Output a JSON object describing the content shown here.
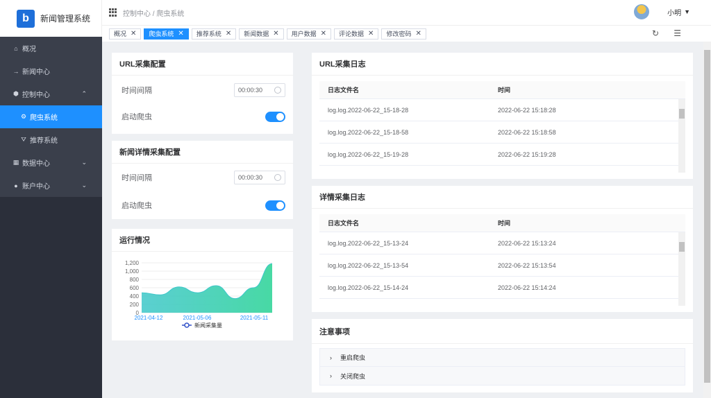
{
  "app": {
    "title": "新闻管理系统",
    "logo_letter": "b"
  },
  "menu": {
    "items": [
      {
        "label": "概况",
        "icon": "home-icon"
      },
      {
        "label": "新闻中心",
        "icon": "arrow-right-icon"
      },
      {
        "label": "控制中心",
        "icon": "cube-icon",
        "expanded": true
      },
      {
        "label": "爬虫系统",
        "icon": "gear-icon",
        "active": true
      },
      {
        "label": "推荐系统",
        "icon": "filter-icon"
      },
      {
        "label": "数据中心",
        "icon": "data-icon"
      },
      {
        "label": "账户中心",
        "icon": "user-icon"
      }
    ]
  },
  "header": {
    "breadcrumb": "控制中心 / 爬虫系统",
    "username": "小明"
  },
  "tags": [
    "概况",
    "爬虫系统",
    "推荐系统",
    "新闻数据",
    "用户数据",
    "评论数据",
    "修改密码"
  ],
  "active_tag": "爬虫系统",
  "url_config": {
    "title": "URL采集配置",
    "interval_label": "时间间隔",
    "interval_value": "00:00:30",
    "start_label": "启动爬虫",
    "start_on": true
  },
  "detail_config": {
    "title": "新闻详情采集配置",
    "interval_label": "时间间隔",
    "interval_value": "00:00:30",
    "start_label": "启动爬虫",
    "start_on": true
  },
  "status": {
    "title": "运行情况"
  },
  "chart_data": {
    "type": "area",
    "x": [
      "2021-04-12",
      "2021-05-06",
      "2021-05-11"
    ],
    "yticks": [
      "1,200",
      "1,000",
      "800",
      "600",
      "400",
      "200",
      "0"
    ],
    "ylim": [
      0,
      1200
    ],
    "series": [
      {
        "name": "新闻采集量",
        "values": [
          480,
          430,
          620,
          480,
          650,
          340,
          600,
          1180
        ]
      }
    ],
    "legend_position": "bottom",
    "color": "#3ec7c9"
  },
  "url_log": {
    "title": "URL采集日志",
    "col_file": "日志文件名",
    "col_time": "时间",
    "rows": [
      [
        "log.log.2022-06-22_15-18-28",
        "2022-06-22 15:18:28"
      ],
      [
        "log.log.2022-06-22_15-18-58",
        "2022-06-22 15:18:58"
      ],
      [
        "log.log.2022-06-22_15-19-28",
        "2022-06-22 15:19:28"
      ]
    ]
  },
  "detail_log": {
    "title": "详情采集日志",
    "col_file": "日志文件名",
    "col_time": "时间",
    "rows": [
      [
        "log.log.2022-06-22_15-13-24",
        "2022-06-22 15:13:24"
      ],
      [
        "log.log.2022-06-22_15-13-54",
        "2022-06-22 15:13:54"
      ],
      [
        "log.log.2022-06-22_15-14-24",
        "2022-06-22 15:14:24"
      ]
    ]
  },
  "notes": {
    "title": "注意事项",
    "items": [
      "重启爬虫",
      "关闭爬虫"
    ]
  }
}
